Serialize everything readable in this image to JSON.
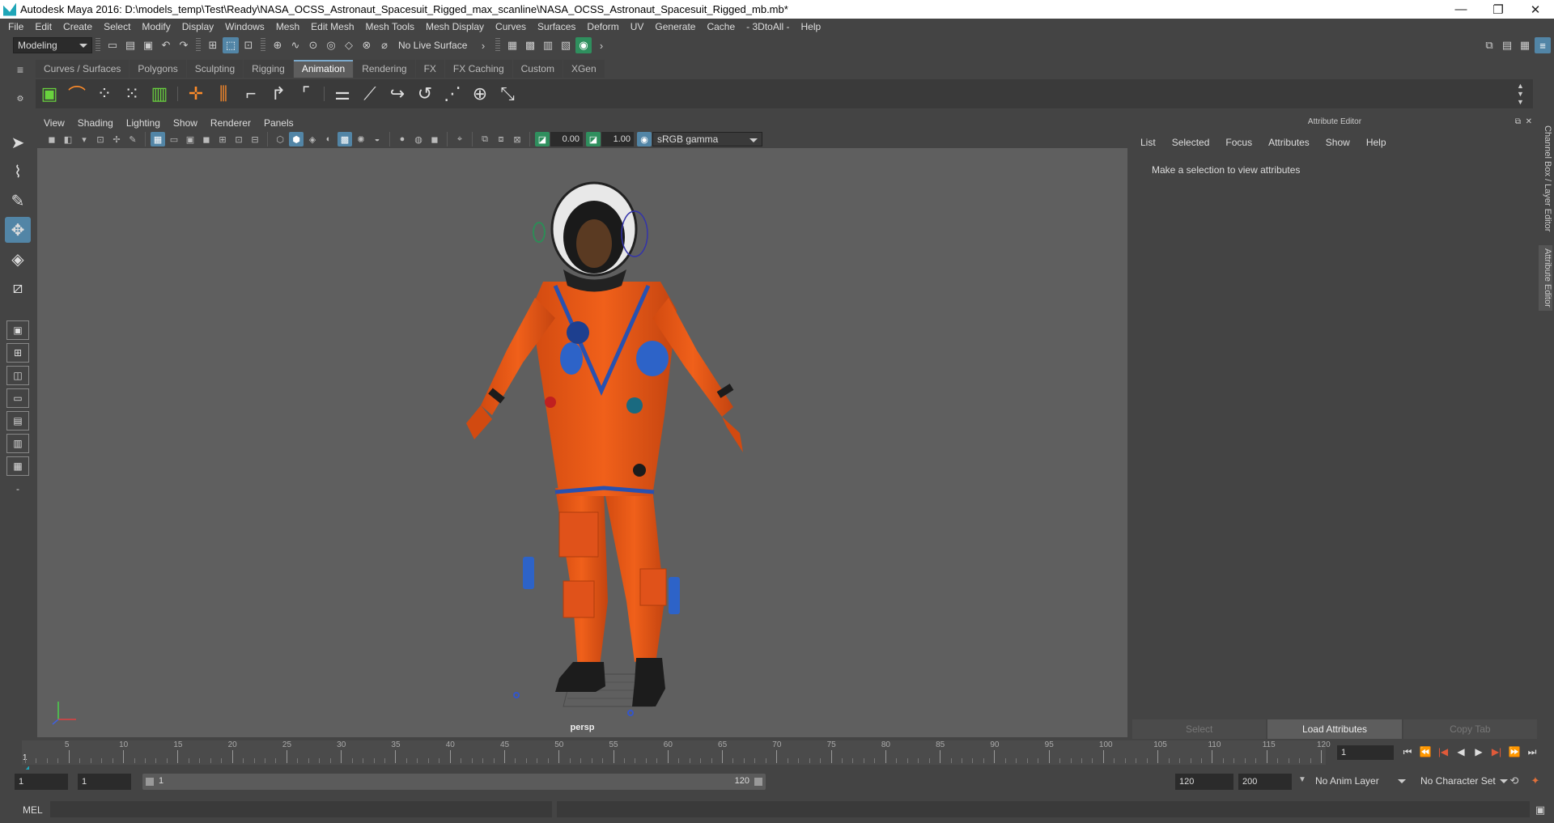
{
  "title_bar": {
    "title": "Autodesk Maya 2016: D:\\models_temp\\Test\\Ready\\NASA_OCSS_Astronaut_Spacesuit_Rigged_max_scanline\\NASA_OCSS_Astronaut_Spacesuit_Rigged_mb.mb*",
    "minimize": "—",
    "restore": "❐",
    "close": "✕"
  },
  "menu": [
    "File",
    "Edit",
    "Create",
    "Select",
    "Modify",
    "Display",
    "Windows",
    "Mesh",
    "Edit Mesh",
    "Mesh Tools",
    "Mesh Display",
    "Curves",
    "Surfaces",
    "Deform",
    "UV",
    "Generate",
    "Cache",
    "- 3DtoAll -",
    "Help"
  ],
  "status_line": {
    "menu_set": "Modeling",
    "live_surface": "No Live Surface"
  },
  "shelf": {
    "tabs": [
      "Curves / Surfaces",
      "Polygons",
      "Sculpting",
      "Rigging",
      "Animation",
      "Rendering",
      "FX",
      "FX Caching",
      "Custom",
      "XGen"
    ],
    "active_tab": "Animation"
  },
  "viewport": {
    "menus": [
      "View",
      "Shading",
      "Lighting",
      "Show",
      "Renderer",
      "Panels"
    ],
    "exposure": "0.00",
    "gamma": "1.00",
    "color_space": "sRGB gamma",
    "camera_label": "persp"
  },
  "attribute_editor": {
    "header": "Attribute Editor",
    "menus": [
      "List",
      "Selected",
      "Focus",
      "Attributes",
      "Show",
      "Help"
    ],
    "message": "Make a selection to view attributes",
    "buttons": {
      "select": "Select",
      "load": "Load Attributes",
      "copy_tab": "Copy Tab"
    }
  },
  "side_tabs": {
    "channel_box": "Channel Box / Layer Editor",
    "attribute_editor": "Attribute Editor"
  },
  "timeline": {
    "labels": [
      "5",
      "10",
      "15",
      "20",
      "25",
      "30",
      "35",
      "40",
      "45",
      "50",
      "55",
      "60",
      "65",
      "70",
      "75",
      "80",
      "85",
      "90",
      "95",
      "100",
      "105",
      "110",
      "115",
      "120"
    ],
    "current_frame_marker": "1",
    "current_frame_field": "1"
  },
  "range_slider": {
    "start_time": "1",
    "playback_start": "1",
    "range_start_label": "1",
    "range_end_label": "120",
    "playback_end": "120",
    "end_time": "200",
    "anim_layer": "No Anim Layer",
    "character_set": "No Character Set"
  },
  "command_line": {
    "language": "MEL"
  }
}
